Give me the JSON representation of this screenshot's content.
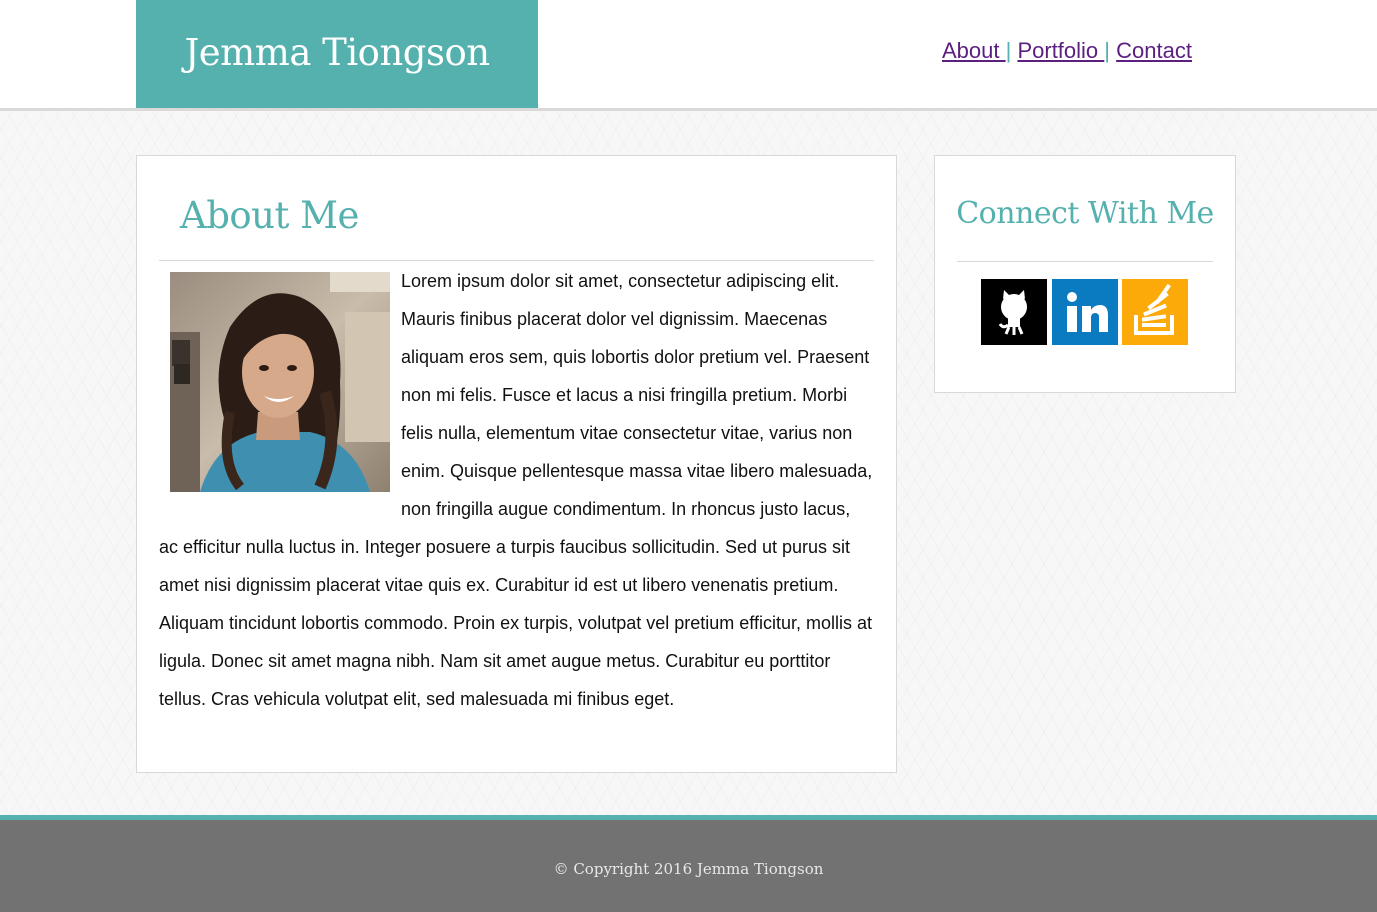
{
  "header": {
    "brand": "Jemma Tiongson",
    "nav": [
      {
        "label": "About "
      },
      {
        "label": "Portfolio "
      },
      {
        "label": "Contact"
      }
    ],
    "separator": "|"
  },
  "about": {
    "title": "About Me",
    "body": "Lorem ipsum dolor sit amet, consectetur adipiscing elit. Mauris finibus placerat dolor vel dignissim. Maecenas aliquam eros sem, quis lobortis dolor pretium vel. Praesent non mi felis. Fusce et lacus a nisi fringilla pretium. Morbi felis nulla, elementum vitae consectetur vitae, varius non enim. Quisque pellentesque massa vitae libero malesuada, non fringilla augue condimentum. In rhoncus justo lacus, ac efficitur nulla luctus in. Integer posuere a turpis faucibus sollicitudin. Sed ut purus sit amet nisi dignissim placerat vitae quis ex. Curabitur id est ut libero venenatis pretium. Aliquam tincidunt lobortis commodo. Proin ex turpis, volutpat vel pretium efficitur, mollis at ligula. Donec sit amet magna nibh. Nam sit amet augue metus. Curabitur eu porttitor tellus. Cras vehicula volutpat elit, sed malesuada mi finibus eget."
  },
  "connect": {
    "title": "Connect With Me",
    "links": [
      {
        "icon": "github-icon",
        "color": "#000000"
      },
      {
        "icon": "linkedin-icon",
        "color": "#0a7bc1"
      },
      {
        "icon": "stackoverflow-icon",
        "color": "#fbaa0a"
      }
    ]
  },
  "footer": {
    "copyright": "© Copyright 2016 Jemma Tiongson"
  },
  "colors": {
    "accent": "#55b1ae",
    "link_visited": "#5b1f80",
    "footer_bg": "#727272"
  }
}
